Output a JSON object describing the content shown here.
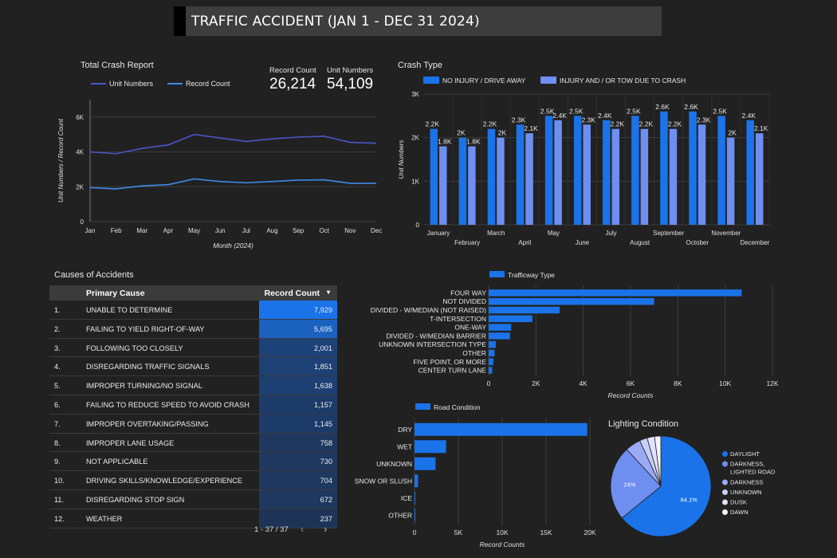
{
  "header": {
    "title": "TRAFFIC ACCIDENT (JAN 1 - DEC 31 2024)"
  },
  "crash_report": {
    "title": "Total Crash Report",
    "record_count_label": "Record Count",
    "record_count_value": "26,214",
    "unit_numbers_label": "Unit Numbers",
    "unit_numbers_value": "54,109"
  },
  "crash_type": {
    "title": "Crash Type"
  },
  "causes": {
    "title": "Causes of Accidents",
    "col_cause": "Primary Cause",
    "col_count": "Record Count",
    "sort_icon": "caret-down-icon",
    "pager_text": "1 - 37 / 37"
  },
  "lighting": {
    "title": "Lighting Condition"
  },
  "chart_data": [
    {
      "type": "line",
      "title": "Total Crash Report",
      "xlabel": "Month (2024)",
      "ylabel": "Unit Numbers / Record Count",
      "categories": [
        "Jan",
        "Feb",
        "Mar",
        "Apr",
        "May",
        "Jun",
        "Jul",
        "Aug",
        "Sep",
        "Oct",
        "Nov",
        "Dec"
      ],
      "yticks": [
        "0",
        "2K",
        "4K",
        "6K"
      ],
      "ylim": [
        0,
        7000
      ],
      "series": [
        {
          "name": "Unit Numbers",
          "color": "#4a56c8",
          "values": [
            4000,
            3900,
            4200,
            4400,
            5000,
            4800,
            4600,
            4750,
            4850,
            4900,
            4550,
            4500
          ]
        },
        {
          "name": "Record Count",
          "color": "#3d8be8",
          "values": [
            1950,
            1880,
            2050,
            2120,
            2450,
            2300,
            2230,
            2300,
            2380,
            2400,
            2200,
            2200
          ]
        }
      ],
      "legend_position": "top-left"
    },
    {
      "type": "bar",
      "title": "Crash Type",
      "ylabel": "Unit Numbers",
      "categories": [
        "January",
        "February",
        "March",
        "April",
        "May",
        "June",
        "July",
        "August",
        "September",
        "October",
        "November",
        "December"
      ],
      "yticks": [
        "0",
        "1K",
        "2K",
        "3K"
      ],
      "ylim": [
        0,
        3000
      ],
      "series": [
        {
          "name": "NO INJURY / DRIVE AWAY",
          "color": "#1a73e8",
          "values": [
            2200,
            2000,
            2200,
            2300,
            2500,
            2500,
            2400,
            2500,
            2600,
            2600,
            2500,
            2400
          ],
          "labels": [
            "2.2K",
            "2K",
            "2.2K",
            "2.3K",
            "2.5K",
            "2.5K",
            "2.4K",
            "2.5K",
            "2.6K",
            "2.6K",
            "2.5K",
            "2.4K"
          ]
        },
        {
          "name": "INJURY AND / OR TOW DUE TO CRASH",
          "color": "#6e8ef0",
          "values": [
            1800,
            1800,
            2000,
            2100,
            2400,
            2300,
            2200,
            2200,
            2200,
            2300,
            2000,
            2100
          ],
          "labels": [
            "1.8K",
            "1.8K",
            "2K",
            "2.1K",
            "2.4K",
            "2.3K",
            "2.2K",
            "2.2K",
            "2.2K",
            "2.3K",
            "2K",
            "2.1K"
          ]
        }
      ],
      "legend_position": "top"
    },
    {
      "type": "table",
      "title": "Causes of Accidents",
      "columns": [
        "Primary Cause",
        "Record Count"
      ],
      "rows": [
        {
          "num": "1.",
          "cause": "UNABLE TO DETERMINE",
          "count": "7,929",
          "value": 7929
        },
        {
          "num": "2.",
          "cause": "FAILING TO YIELD RIGHT-OF-WAY",
          "count": "5,695",
          "value": 5695
        },
        {
          "num": "3.",
          "cause": "FOLLOWING TOO CLOSELY",
          "count": "2,001",
          "value": 2001
        },
        {
          "num": "4.",
          "cause": "DISREGARDING TRAFFIC SIGNALS",
          "count": "1,851",
          "value": 1851
        },
        {
          "num": "5.",
          "cause": "IMPROPER TURNING/NO SIGNAL",
          "count": "1,638",
          "value": 1638
        },
        {
          "num": "6.",
          "cause": "FAILING TO REDUCE SPEED TO AVOID CRASH",
          "count": "1,157",
          "value": 1157
        },
        {
          "num": "7.",
          "cause": "IMPROPER OVERTAKING/PASSING",
          "count": "1,145",
          "value": 1145
        },
        {
          "num": "8.",
          "cause": "IMPROPER LANE USAGE",
          "count": "758",
          "value": 758
        },
        {
          "num": "9.",
          "cause": "NOT APPLICABLE",
          "count": "730",
          "value": 730
        },
        {
          "num": "10.",
          "cause": "DRIVING SKILLS/KNOWLEDGE/EXPERIENCE",
          "count": "704",
          "value": 704
        },
        {
          "num": "11.",
          "cause": "DISREGARDING STOP SIGN",
          "count": "672",
          "value": 672
        },
        {
          "num": "12.",
          "cause": "WEATHER",
          "count": "237",
          "value": 237
        }
      ]
    },
    {
      "type": "bar",
      "orientation": "horizontal",
      "legend": "Trafficway Type",
      "xlabel": "Record Counts",
      "xticks": [
        "0",
        "2K",
        "4K",
        "6K",
        "8K",
        "10K",
        "12K"
      ],
      "xlim": [
        0,
        12000
      ],
      "categories": [
        "FOUR WAY",
        "NOT DIVIDED",
        "DIVIDED - W/MEDIAN (NOT RAISED)",
        "T-INTERSECTION",
        "ONE-WAY",
        "DIVIDED - W/MEDIAN BARRIER",
        "UNKNOWN INTERSECTION TYPE",
        "OTHER",
        "FIVE POINT, OR MORE",
        "CENTER TURN LANE"
      ],
      "values": [
        10700,
        7000,
        3000,
        1850,
        950,
        900,
        300,
        250,
        200,
        150
      ],
      "color": "#1a73e8"
    },
    {
      "type": "bar",
      "orientation": "horizontal",
      "legend": "Road Condition",
      "xlabel": "Record Counts",
      "xticks": [
        "0",
        "5K",
        "10K",
        "15K",
        "20K"
      ],
      "xlim": [
        0,
        20000
      ],
      "categories": [
        "DRY",
        "WET",
        "UNKNOWN",
        "SNOW OR SLUSH",
        "ICE",
        "OTHER"
      ],
      "values": [
        19700,
        3600,
        2400,
        400,
        60,
        30
      ],
      "color": "#1a73e8"
    },
    {
      "type": "pie",
      "title": "Lighting Condition",
      "categories": [
        "DAYLIGHT",
        "DARKNESS, LIGHTED ROAD",
        "DARKNESS",
        "UNKNOWN",
        "DUSK",
        "DAWN"
      ],
      "values": [
        64.1,
        24,
        5,
        2.5,
        2.4,
        2
      ],
      "labels": [
        "64.1%",
        "24%",
        "",
        "",
        "",
        ""
      ],
      "colors": [
        "#1a73e8",
        "#6e8ef0",
        "#9aaaf5",
        "#c6cff9",
        "#dde3fc",
        "#f4f6ff"
      ],
      "legend_position": "right"
    }
  ]
}
